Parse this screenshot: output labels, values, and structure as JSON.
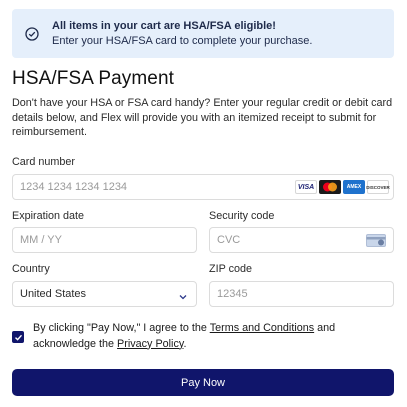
{
  "banner": {
    "icon": "check-circle-icon",
    "title": "All items in your cart are HSA/FSA eligible!",
    "subtitle": "Enter your HSA/FSA card to complete your purchase."
  },
  "page": {
    "title": "HSA/FSA Payment",
    "description": "Don't have your HSA or FSA card handy? Enter your regular credit or debit card details below, and Flex will provide you with an itemized receipt to submit for reimbursement."
  },
  "form": {
    "card_number": {
      "label": "Card number",
      "placeholder": "1234 1234 1234 1234",
      "value": ""
    },
    "card_logos": [
      "VISA",
      "",
      "AMEX",
      "DISCOVER"
    ],
    "expiration": {
      "label": "Expiration date",
      "placeholder": "MM / YY",
      "value": ""
    },
    "security_code": {
      "label": "Security code",
      "placeholder": "CVC",
      "value": "",
      "icon": "cvc-card-icon"
    },
    "country": {
      "label": "Country",
      "value": "United States"
    },
    "zip": {
      "label": "ZIP code",
      "placeholder": "12345",
      "value": ""
    }
  },
  "consent": {
    "checked": true,
    "text_before": "By clicking \"Pay Now,\" I agree to the ",
    "terms_link": "Terms and Conditions",
    "text_middle": " and acknowledge the ",
    "privacy_link": "Privacy Policy",
    "text_after": "."
  },
  "actions": {
    "pay_label": "Pay Now"
  },
  "colors": {
    "accent": "#10156b",
    "banner_bg": "#e5effb"
  }
}
